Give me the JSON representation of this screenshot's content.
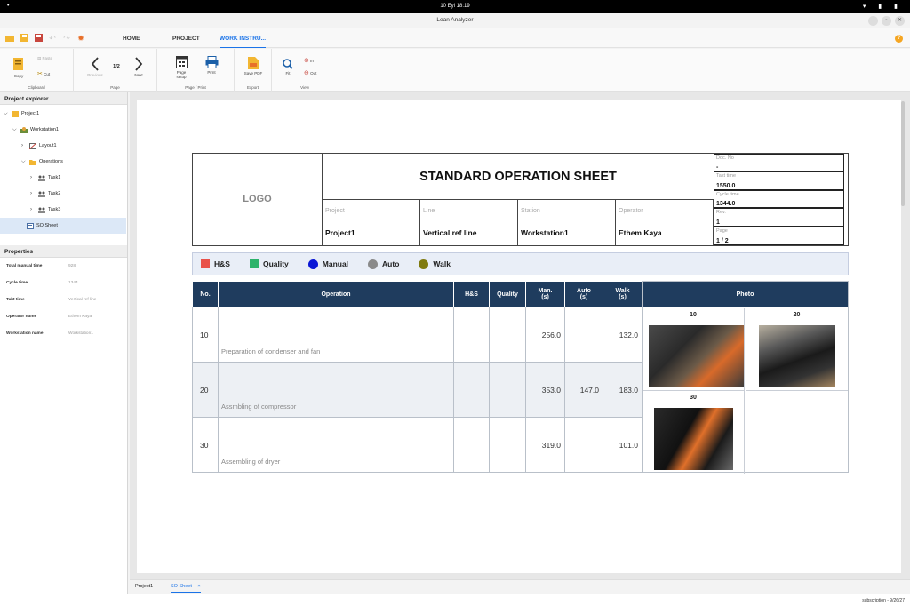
{
  "status_bar": {
    "left": "•",
    "time": "10 Eyl 18:19",
    "right": "▾ ▮ ▮"
  },
  "window": {
    "title": "Lean Analyzer",
    "min": "–",
    "max": "▫",
    "close": "✕"
  },
  "tabs": {
    "home": "HOME",
    "project": "PROJECT",
    "work": "WORK INSTRU..."
  },
  "ribbon": {
    "copy": "Copy",
    "paste": "Paste",
    "cut": "Cut",
    "clipboard": "Clipboard",
    "previous": "Previous",
    "page_num": "1/2",
    "next": "Next",
    "page": "Page",
    "page_setup": "Page setup",
    "print": "Print",
    "page_print": "Page / Print",
    "save_pdf": "Save PDF",
    "export": "Export",
    "fit": "Fit",
    "zoom_in": "In",
    "zoom_out": "Out",
    "view": "View"
  },
  "explorer": {
    "title": "Project explorer",
    "project": "Project1",
    "workstation": "Workstation1",
    "layout": "Layout1",
    "operations": "Operations",
    "task1": "Task1",
    "task2": "Task2",
    "task3": "Task3",
    "so_sheet": "SO Sheet"
  },
  "properties": {
    "title": "Properties",
    "rows": [
      {
        "k": "Total manual time",
        "v": "928"
      },
      {
        "k": "Cycle time",
        "v": "1344"
      },
      {
        "k": "Takt time",
        "v": "Vertical ref line"
      },
      {
        "k": "Operator name",
        "v": "Ethem Kaya"
      },
      {
        "k": "Workstation name",
        "v": "Workstation1"
      }
    ]
  },
  "sheet": {
    "logo": "LOGO",
    "title": "STANDARD OPERATION SHEET",
    "project_label": "Project",
    "project": "Project1",
    "line_label": "Line",
    "line": "Vertical ref line",
    "station_label": "Station",
    "station": "Workstation1",
    "operator_label": "Operator",
    "operator": "Ethem Kaya",
    "doc_label": "Doc. No",
    "doc": "-",
    "takt_label": "Takt time",
    "takt": "1550.0",
    "cycle_label": "Cycle time",
    "cycle": "1344.0",
    "rev_label": "Rev.",
    "rev": "1",
    "page_label": "Page",
    "page": "1 / 2"
  },
  "legend": {
    "hs": "H&S",
    "quality": "Quality",
    "manual": "Manual",
    "auto": "Auto",
    "walk": "Walk",
    "colors": {
      "hs": "#e9524a",
      "quality": "#2db36b",
      "manual": "#0a17d6",
      "auto": "#8a8a8a",
      "walk": "#7f7a0f"
    }
  },
  "table": {
    "h_no": "No.",
    "h_op": "Operation",
    "h_hs": "H&S",
    "h_quality": "Quality",
    "h_man": "Man.",
    "h_auto": "Auto",
    "h_walk": "Walk",
    "h_unit": "(s)",
    "h_photo": "Photo",
    "rows": [
      {
        "no": "10",
        "op": "Preparation of condenser and fan",
        "man": "256.0",
        "auto": "",
        "walk": "132.0"
      },
      {
        "no": "20",
        "op": "Assmbling of compressor",
        "man": "353.0",
        "auto": "147.0",
        "walk": "183.0"
      },
      {
        "no": "30",
        "op": "Assembling of dryer",
        "man": "319.0",
        "auto": "",
        "walk": "101.0"
      }
    ],
    "photos": [
      "10",
      "20",
      "30"
    ]
  },
  "bottom_tabs": {
    "project": "Project1",
    "so": "SO Sheet",
    "close": "×"
  },
  "footer": {
    "subscription": "subscription - 9/26/27"
  }
}
